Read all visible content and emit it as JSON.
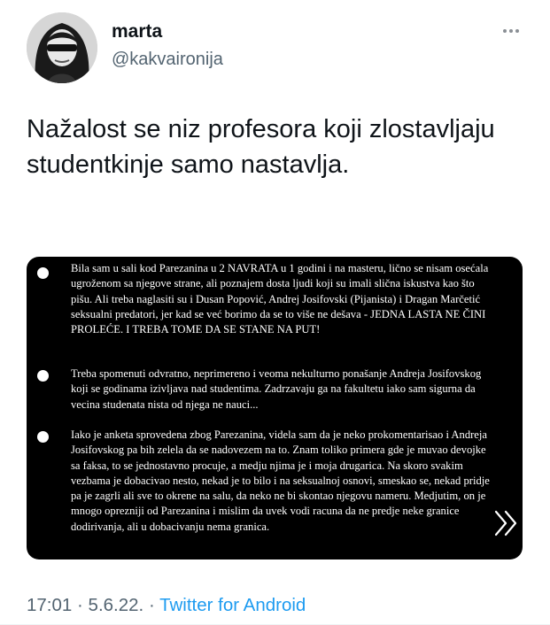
{
  "author": {
    "display_name": "marta",
    "handle": "@kakvaironija"
  },
  "tweet": {
    "text": "Nažalost se niz profesora koji zlostavljaju studentkinje samo nastavlja."
  },
  "media": {
    "bullets": [
      "Bila sam u sali kod Parezanina u 2 NAVRATA u 1 godini i na masteru, lično se nisam osećala ugroženom sa njegove strane, ali poznajem dosta ljudi koji su imali slična iskustva kao što pišu. Ali treba naglasiti su i Dusan Popović, Andrej Josifovski (Pijanista) i Dragan Marčetić seksualni predatori, jer kad se već borimo da se to više ne dešava - JEDNA LASTA NE ČINI PROLEĆE. I TREBA TOME DA SE STANE NA PUT!",
      "Treba spomenuti odvratno, neprimereno i veoma nekulturno ponašanje Andreja Josifovskog koji se godinama izivljava nad studentima. Zadrzavaju ga na fakultetu iako sam sigurna da vecina studenata nista od njega ne nauci...",
      "Iako je anketa sprovedena zbog Parezanina, videla sam da je neko prokomentarisao i Andreja Josifovskog pa bih zelela da se nadovezem na to. Znam toliko primera gde je muvao devojke sa faksa, to se jednostavno procuje, a medju njima je i moja drugarica. Na skoro svakim vezbama je dobacivao nesto, nekad je to bilo i na seksualnoj osnovi, smeskao se, nekad pridje pa je zagrli ali sve to okrene na salu, da neko ne bi skontao njegovu nameru. Medjutim, on je mnogo oprezniji od Parezanina i mislim da uvek vodi racuna da ne predje neke granice dodirivanja, ali u dobacivanju nema granica."
    ],
    "next_icon": "double-chevron-right-icon"
  },
  "meta": {
    "time": "17:01",
    "sep1": "·",
    "date": "5.6.22.",
    "sep2": "·",
    "source": "Twitter for Android"
  },
  "colors": {
    "text": "#0f1419",
    "secondary": "#536471",
    "link": "#1d9bf0",
    "media_bg": "#000000"
  }
}
